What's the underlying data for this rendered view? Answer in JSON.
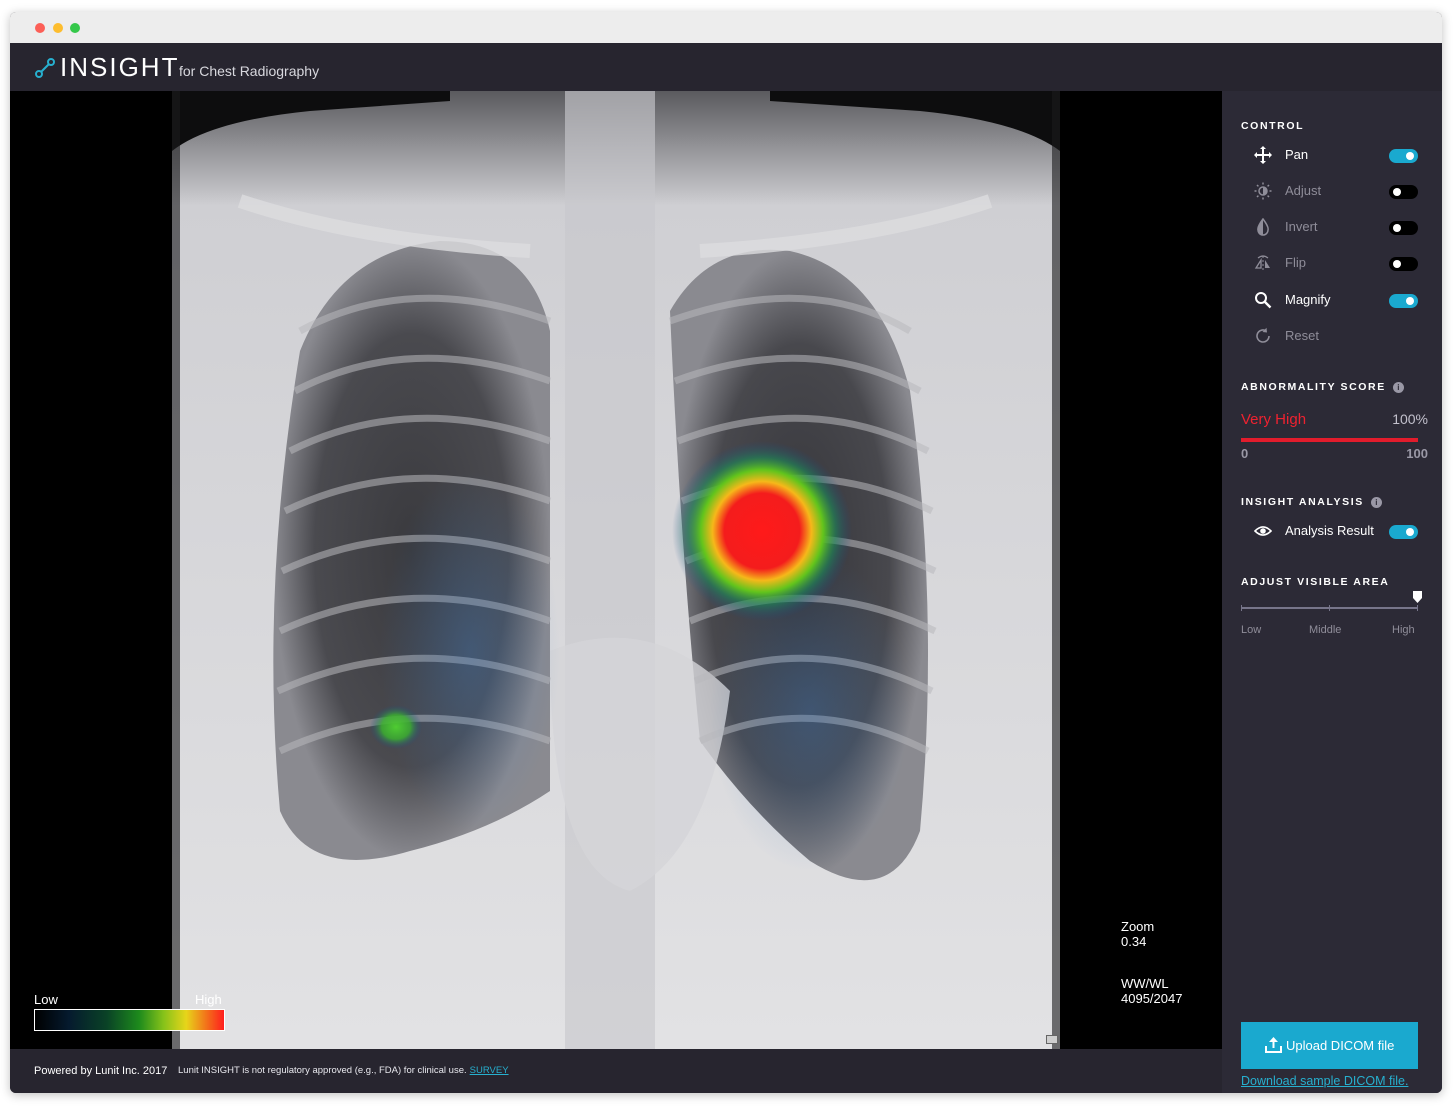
{
  "app": {
    "brand": "INSIGHT",
    "subtitle": "for Chest Radiography"
  },
  "viewer": {
    "zoom_label": "Zoom",
    "zoom_value": "0.34",
    "wwwl_label": "WW/WL",
    "wwwl_value": "4095/2047",
    "legend_low": "Low",
    "legend_high": "High"
  },
  "footer": {
    "powered": "Powered by Lunit Inc. 2017",
    "disclaimer": "Lunit INSIGHT is not regulatory approved (e.g., FDA) for clinical use.",
    "survey": "SURVEY"
  },
  "panel": {
    "control_title": "CONTROL",
    "controls": [
      {
        "label": "Pan",
        "icon": "pan-icon",
        "active": true,
        "toggle": "on"
      },
      {
        "label": "Adjust",
        "icon": "brightness-icon",
        "active": false,
        "toggle": "off"
      },
      {
        "label": "Invert",
        "icon": "drop-icon",
        "active": false,
        "toggle": "off"
      },
      {
        "label": "Flip",
        "icon": "flip-icon",
        "active": false,
        "toggle": "off"
      },
      {
        "label": "Magnify",
        "icon": "magnifier-icon",
        "active": true,
        "toggle": "on"
      },
      {
        "label": "Reset",
        "icon": "reset-icon",
        "active": false,
        "toggle": null
      }
    ],
    "score_title": "ABNORMALITY SCORE",
    "score_level": "Very High",
    "score_percent": "100%",
    "score_value": 100,
    "score_min": "0",
    "score_max": "100",
    "analysis_title": "INSIGHT ANALYSIS",
    "analysis_label": "Analysis Result",
    "analysis_toggle": "on",
    "visible_title": "ADJUST VISIBLE AREA",
    "visible_labels": [
      "Low",
      "Middle",
      "High"
    ],
    "visible_level": "High",
    "upload_label": "Upload DICOM file",
    "download_label": "Download sample DICOM file."
  },
  "colors": {
    "accent": "#1aa9cf",
    "score_red": "#e21c2c",
    "panel_bg": "#2c2a36"
  }
}
